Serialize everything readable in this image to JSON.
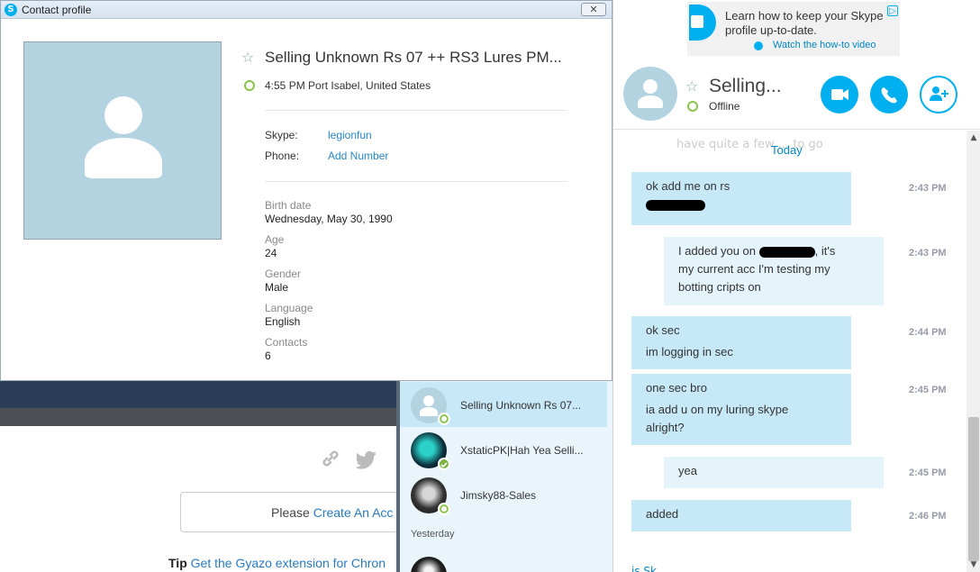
{
  "profile_window": {
    "title": "Contact profile",
    "close_glyph": "✕",
    "name": "Selling Unknown Rs 07 ++ RS3 Lures PM...",
    "location": "4:55 PM Port Isabel, United States",
    "skype_label": "Skype:",
    "skype_value": "legionfun",
    "phone_label": "Phone:",
    "phone_value": "Add Number",
    "fields": [
      {
        "label": "Birth date",
        "value": "Wednesday, May 30, 1990"
      },
      {
        "label": "Age",
        "value": "24"
      },
      {
        "label": "Gender",
        "value": "Male"
      },
      {
        "label": "Language",
        "value": "English"
      },
      {
        "label": "Contacts",
        "value": "6"
      }
    ]
  },
  "ad": {
    "text": "Learn how to keep your Skype profile up-to-date.",
    "link": "Watch the how-to video"
  },
  "chat": {
    "name": "Selling...",
    "status": "Offline",
    "faded_text": "have quite a few ... to go",
    "date_label": "Today",
    "messages": [
      {
        "lines": [
          "ok add me on rs"
        ],
        "time": "2:43 PM"
      },
      {
        "lines": [
          "I added you on",
          ", it's",
          "my current acc I'm testing my",
          "botting cripts on"
        ],
        "time": "2:43 PM"
      },
      {
        "lines": [
          "ok sec",
          "im logging in sec"
        ],
        "time": "2:44 PM"
      },
      {
        "lines": [
          "one sec bro",
          "ia add u on my luring skype",
          "alright?"
        ],
        "time": "2:45 PM"
      },
      {
        "lines": [
          "yea"
        ],
        "time": "2:45 PM"
      },
      {
        "lines": [
          "added"
        ],
        "time": "2:46 PM"
      }
    ],
    "bottom_label": "is Sk..."
  },
  "contacts": {
    "items": [
      {
        "name": "Selling Unknown Rs 07..."
      },
      {
        "name": "XstaticPK|Hah Yea Selli..."
      },
      {
        "name": "Jimsky88-Sales"
      }
    ],
    "section_yesterday": "Yesterday"
  },
  "background_page": {
    "login_prefix": "Please",
    "login_link": "Create An Acc",
    "tip_label": "Tip",
    "tip_link": "Get the Gyazo extension for Chron"
  },
  "colors": {
    "skype_blue": "#00aff0",
    "bubble_in": "#c7e8f7",
    "bubble_out": "#e4f4fa",
    "online_green": "#8bc34a"
  }
}
